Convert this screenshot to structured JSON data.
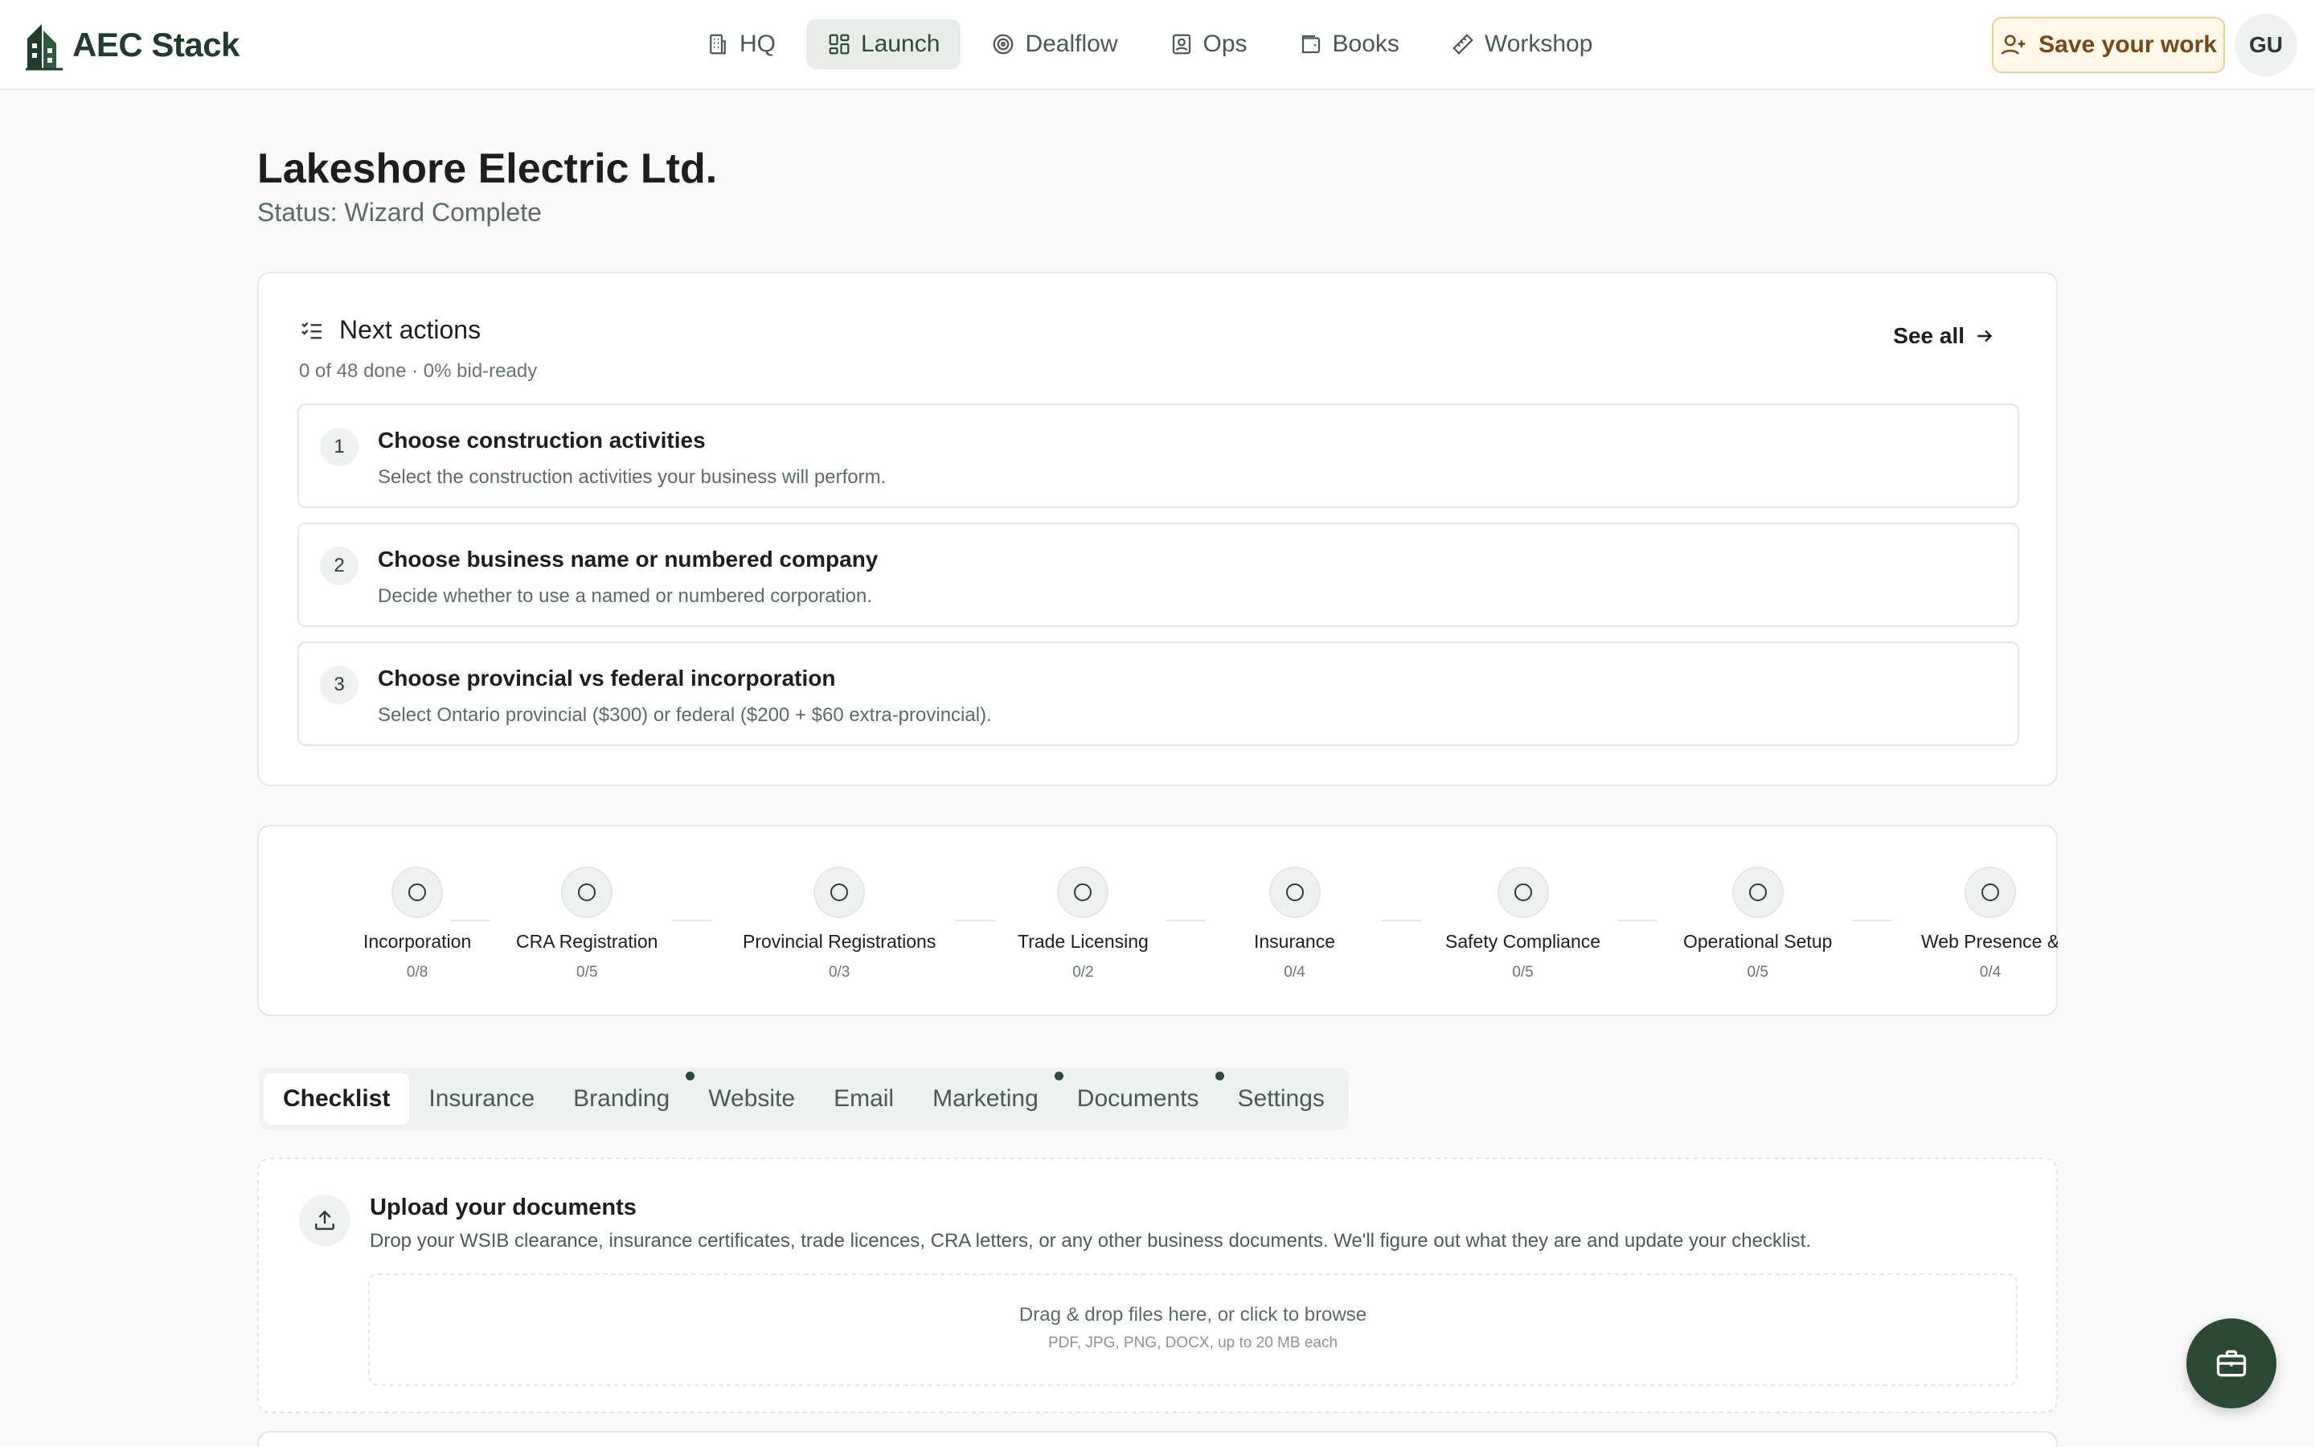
{
  "brand": {
    "name": "AEC Stack"
  },
  "nav": {
    "items": [
      {
        "label": "HQ",
        "icon": "building-icon"
      },
      {
        "label": "Launch",
        "icon": "grid-icon",
        "active": true
      },
      {
        "label": "Dealflow",
        "icon": "target-icon"
      },
      {
        "label": "Ops",
        "icon": "id-badge-icon"
      },
      {
        "label": "Books",
        "icon": "wallet-icon"
      },
      {
        "label": "Workshop",
        "icon": "ruler-icon"
      }
    ],
    "save_label": "Save your work",
    "avatar_initials": "GU"
  },
  "page": {
    "title": "Lakeshore Electric Ltd.",
    "status": "Status: Wizard Complete"
  },
  "next_actions": {
    "title": "Next actions",
    "summary": "0 of 48 done · 0% bid-ready",
    "see_all_label": "See all",
    "items": [
      {
        "number": "1",
        "title": "Choose construction activities",
        "description": "Select the construction activities your business will perform."
      },
      {
        "number": "2",
        "title": "Choose business name or numbered company",
        "description": "Decide whether to use a named or numbered corporation."
      },
      {
        "number": "3",
        "title": "Choose provincial vs federal incorporation",
        "description": "Select Ontario provincial ($300) or federal ($200 + $60 extra-provincial)."
      }
    ]
  },
  "stages": [
    {
      "label": "Incorporation",
      "count": "0/8"
    },
    {
      "label": "CRA Registration",
      "count": "0/5"
    },
    {
      "label": "Provincial Registrations",
      "count": "0/3"
    },
    {
      "label": "Trade Licensing",
      "count": "0/2"
    },
    {
      "label": "Insurance",
      "count": "0/4"
    },
    {
      "label": "Safety Compliance",
      "count": "0/5"
    },
    {
      "label": "Operational Setup",
      "count": "0/5"
    },
    {
      "label": "Web Presence &",
      "count": "0/4"
    }
  ],
  "tabs": [
    {
      "label": "Checklist",
      "active": true
    },
    {
      "label": "Insurance"
    },
    {
      "label": "Branding"
    },
    {
      "label": "Website",
      "has_dot": true
    },
    {
      "label": "Email"
    },
    {
      "label": "Marketing"
    },
    {
      "label": "Documents",
      "has_dot": true
    },
    {
      "label": "Settings",
      "has_dot": true
    }
  ],
  "upload": {
    "title": "Upload your documents",
    "description": "Drop your WSIB clearance, insurance certificates, trade licences, CRA letters, or any other business documents. We'll figure out what they are and update your checklist.",
    "drop_main": "Drag & drop files here, or click to browse",
    "drop_sub": "PDF, JPG, PNG, DOCX, up to 20 MB each"
  },
  "fab": {
    "icon": "briefcase-icon"
  }
}
